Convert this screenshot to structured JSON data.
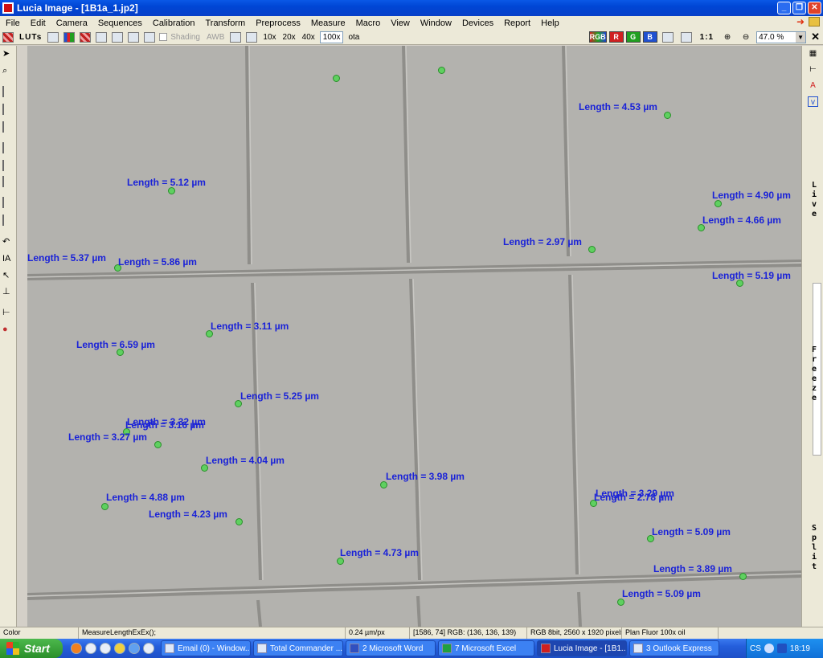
{
  "window": {
    "title": "Lucia Image - [1B1a_1.jp2]",
    "minimize": "_",
    "maximize": "❐",
    "close": "✕"
  },
  "menu": [
    "File",
    "Edit",
    "Camera",
    "Sequences",
    "Calibration",
    "Transform",
    "Preprocess",
    "Measure",
    "Macro",
    "View",
    "Window",
    "Devices",
    "Report",
    "Help"
  ],
  "toolbar": {
    "luts": "LUTs",
    "shading": "Shading",
    "awb": "AWB",
    "objectives": [
      "10x",
      "20x",
      "40x",
      "100x"
    ],
    "selected_objective": "100x",
    "ota": "ota",
    "channels": [
      "RGB",
      "R",
      "G",
      "B"
    ],
    "one_to_one": "1:1",
    "zoom": "47.0 %"
  },
  "side_panel": {
    "live": "Live",
    "freeze": "Freeze",
    "split": "Split"
  },
  "measurements": [
    {
      "label": "Length = 4.53 µm"
    },
    {
      "label": "Length = 5.12 µm"
    },
    {
      "label": "Length = 4.90 µm"
    },
    {
      "label": "Length = 4.66 µm"
    },
    {
      "label": "Length = 2.97 µm"
    },
    {
      "label": "Length = 5.37 µm"
    },
    {
      "label": "Length = 5.86 µm"
    },
    {
      "label": "Length = 5.19 µm"
    },
    {
      "label": "Length = 3.11 µm"
    },
    {
      "label": "Length = 6.59 µm"
    },
    {
      "label": "Length = 5.25 µm"
    },
    {
      "label": "Length = 3.32 µm"
    },
    {
      "label": "Length = 3.16 µm"
    },
    {
      "label": "Length = 3.27 µm"
    },
    {
      "label": "Length = 4.04 µm"
    },
    {
      "label": "Length = 3.98 µm"
    },
    {
      "label": "Length = 4.88 µm"
    },
    {
      "label": "Length = 3.29 µm"
    },
    {
      "label": "Length = 2.78 µm"
    },
    {
      "label": "Length = 4.23 µm"
    },
    {
      "label": "Length = 5.09 µm"
    },
    {
      "label": "Length = 4.73 µm"
    },
    {
      "label": "Length = 3.89 µm"
    },
    {
      "label": "Length = 5.09 µm"
    }
  ],
  "status": {
    "mode": "Color",
    "macro": "MeasureLengthExEx();",
    "calibration": "0.24 µm/px",
    "cursor": "[1586, 74] RGB: (136, 136, 139)",
    "format": "RGB 8bit, 2560 x 1920 pixels",
    "objective": "Plan Fluor 100x oil"
  },
  "taskbar": {
    "start": "Start",
    "tasks": [
      "Email (0) - Window...",
      "Total Commander ...",
      "2 Microsoft Word",
      "7 Microsoft Excel",
      "Lucia Image - [1B1...",
      "3 Outlook Express"
    ],
    "lang": "CS",
    "clock": "18:19"
  }
}
